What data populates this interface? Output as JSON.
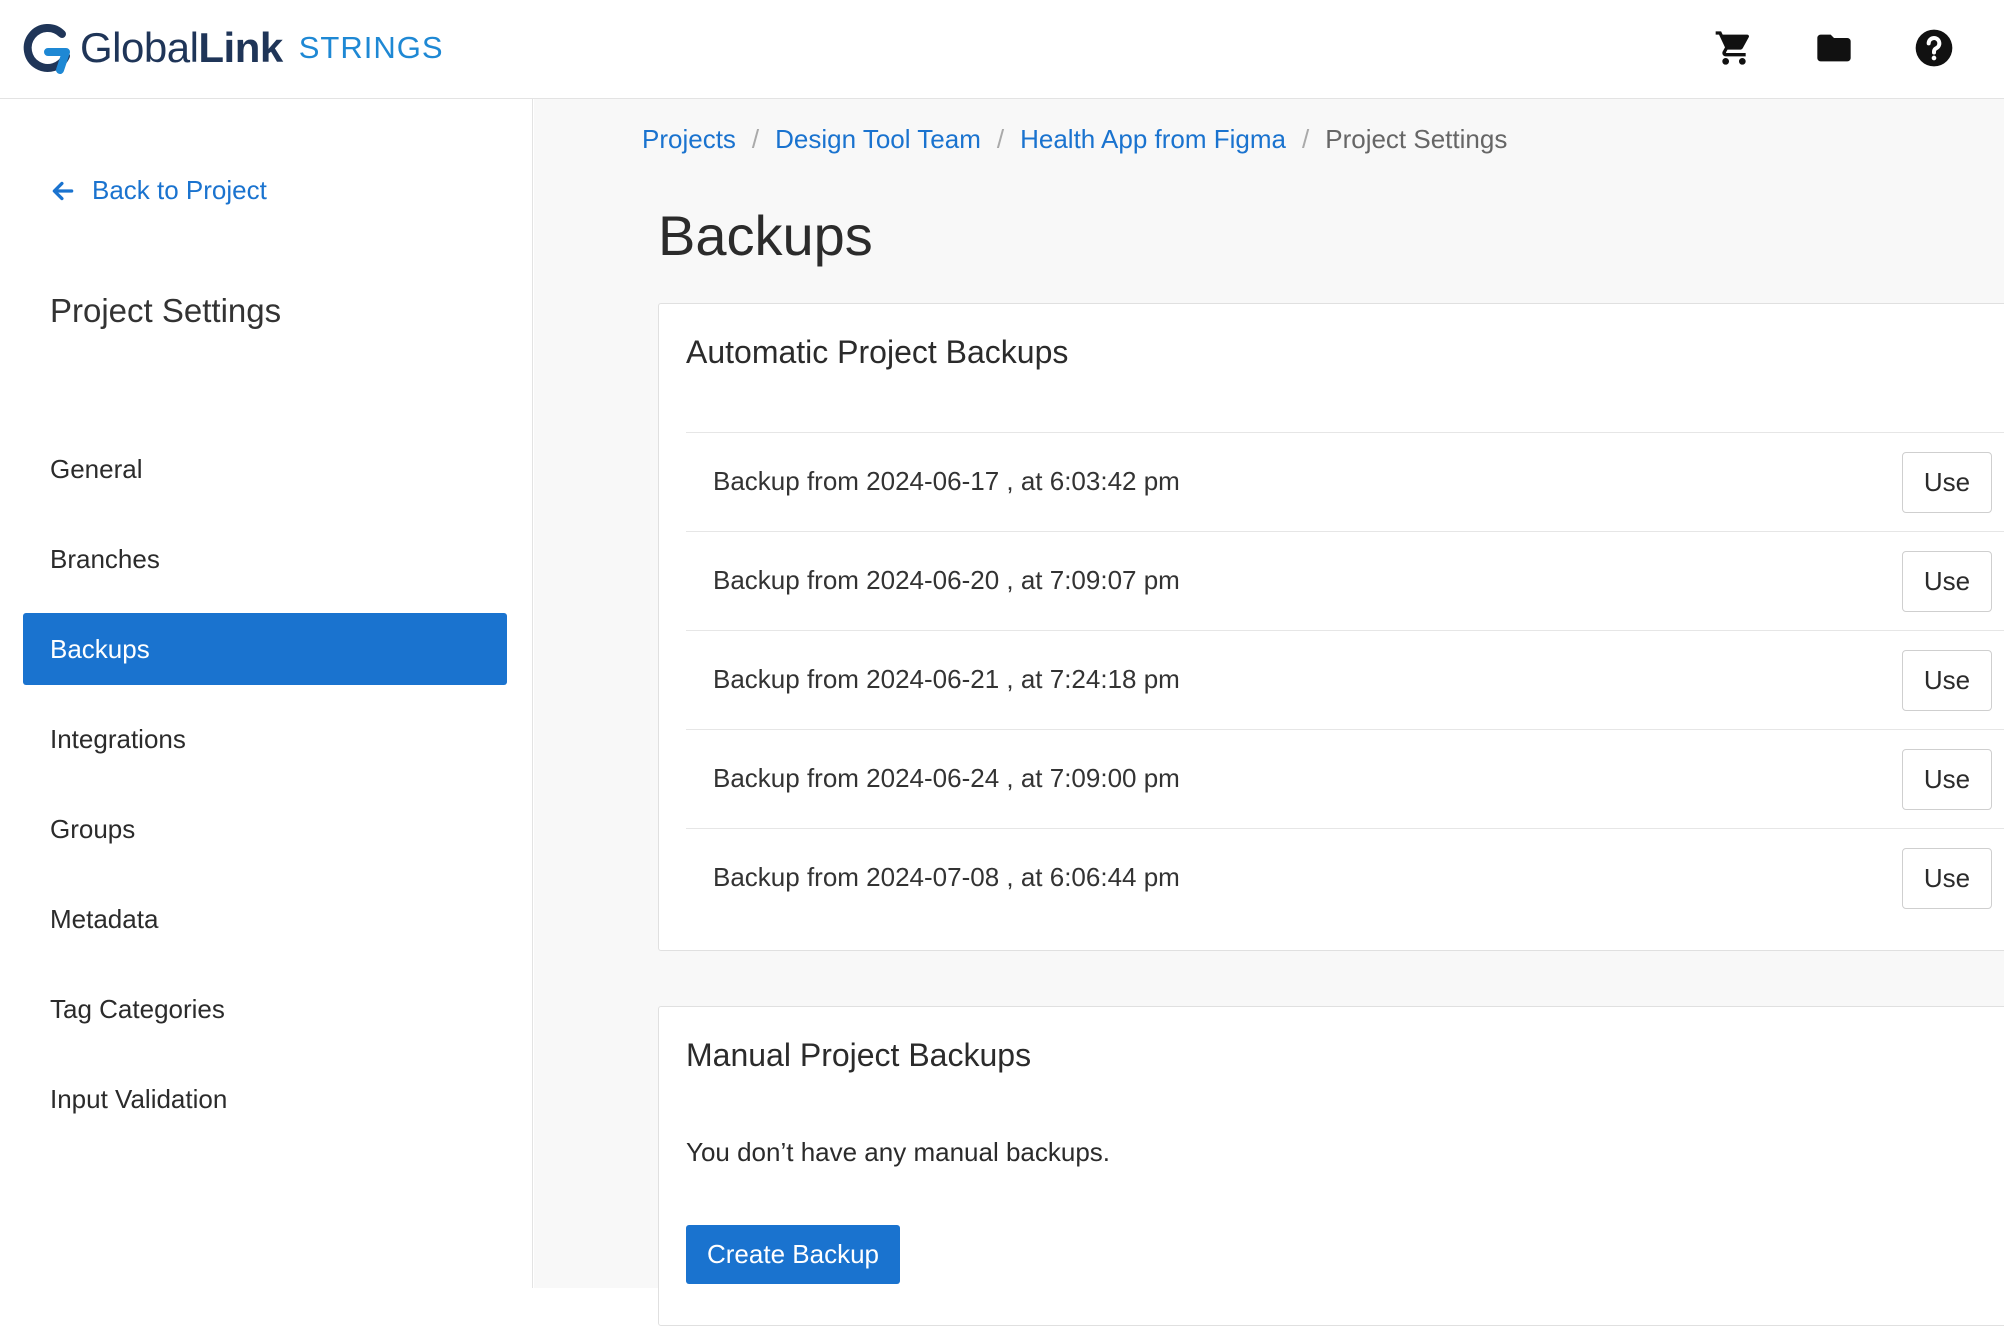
{
  "header": {
    "logo_main_thin": "Global",
    "logo_main_bold": "Link",
    "logo_sub": "STRINGS",
    "icons": [
      "cart-icon",
      "folder-icon",
      "help-icon"
    ]
  },
  "sidebar": {
    "back_label": "Back to Project",
    "section_title": "Project Settings",
    "items": [
      {
        "label": "General",
        "active": false
      },
      {
        "label": "Branches",
        "active": false
      },
      {
        "label": "Backups",
        "active": true
      },
      {
        "label": "Integrations",
        "active": false
      },
      {
        "label": "Groups",
        "active": false
      },
      {
        "label": "Metadata",
        "active": false
      },
      {
        "label": "Tag Categories",
        "active": false
      },
      {
        "label": "Input Validation",
        "active": false
      }
    ]
  },
  "breadcrumb": {
    "items": [
      "Projects",
      "Design Tool Team",
      "Health App from Figma"
    ],
    "current": "Project Settings"
  },
  "main": {
    "title": "Backups",
    "automatic": {
      "title": "Automatic Project Backups",
      "use_label": "Use",
      "backups": [
        "Backup from 2024-06-17 , at 6:03:42 pm",
        "Backup from 2024-06-20 , at 7:09:07 pm",
        "Backup from 2024-06-21 , at 7:24:18 pm",
        "Backup from 2024-06-24 , at 7:09:00 pm",
        "Backup from 2024-07-08 , at 6:06:44 pm"
      ]
    },
    "manual": {
      "title": "Manual Project Backups",
      "empty_message": "You don’t have any manual backups.",
      "create_label": "Create Backup"
    }
  },
  "colors": {
    "accent": "#1a73cf",
    "brand_navy": "#1f3558",
    "brand_light": "#1e88d4"
  }
}
